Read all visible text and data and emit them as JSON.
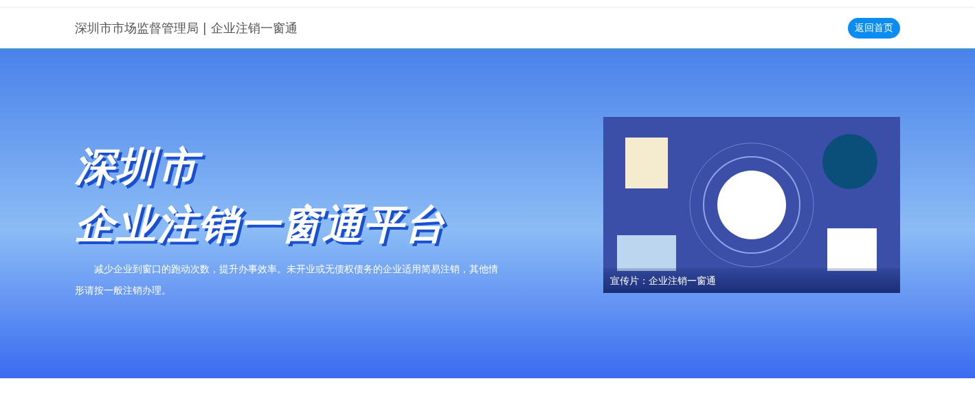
{
  "header": {
    "title": "深圳市市场监督管理局 | 企业注销一窗通",
    "home_button": "返回首页"
  },
  "hero": {
    "title_lines": [
      "深圳市",
      "企业注销一窗通平台"
    ],
    "description": "减少企业到窗口的跑动次数，提升办事效率。未开业或无债权债务的企业适用简易注销，其他情形请按一般注销办理。",
    "video": {
      "caption": "宣传片：企业注销一窗通"
    }
  }
}
